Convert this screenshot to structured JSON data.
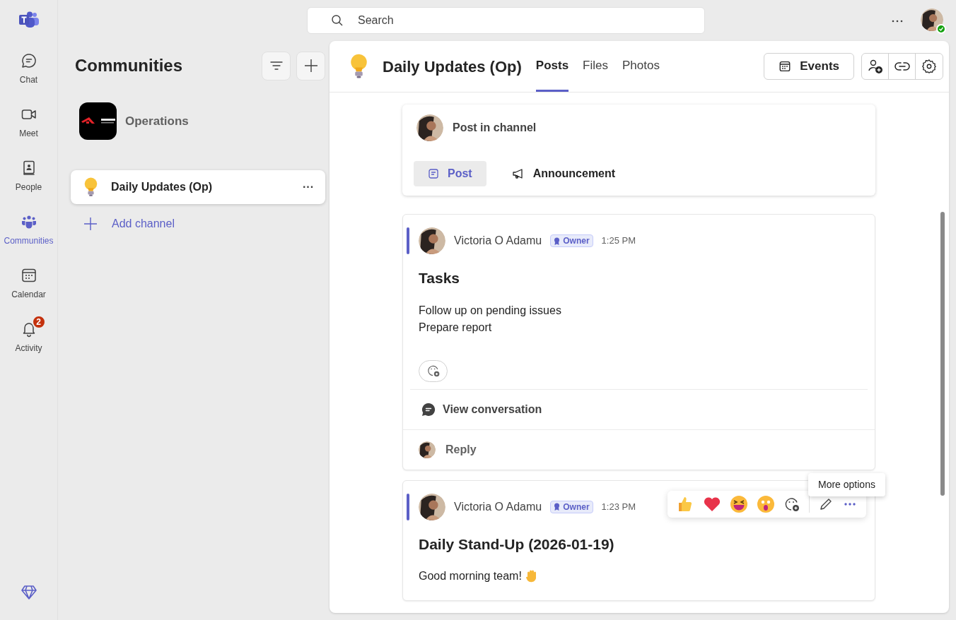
{
  "search": {
    "placeholder": "Search"
  },
  "rail": [
    {
      "label": "Chat",
      "selected": false
    },
    {
      "label": "Meet",
      "selected": false
    },
    {
      "label": "People",
      "selected": false
    },
    {
      "label": "Communities",
      "selected": true
    },
    {
      "label": "Calendar",
      "selected": false
    },
    {
      "label": "Activity",
      "selected": false,
      "badge": "2"
    }
  ],
  "communities": {
    "title": "Communities",
    "community": {
      "name": "Operations"
    },
    "channels": [
      {
        "name": "Daily Updates (Op)",
        "selected": true,
        "more": "···"
      }
    ],
    "add_channel": "Add channel"
  },
  "channel": {
    "title": "Daily Updates (Op)",
    "tabs": [
      {
        "label": "Posts",
        "selected": true
      },
      {
        "label": "Files",
        "selected": false
      },
      {
        "label": "Photos",
        "selected": false
      }
    ],
    "events_button": "Events",
    "composer": {
      "placeholder": "Post in channel",
      "modes": [
        {
          "label": "Post",
          "selected": true
        },
        {
          "label": "Announcement",
          "selected": false
        }
      ]
    },
    "posts": [
      {
        "author": "Victoria O Adamu",
        "role": "Owner",
        "time": "1:25 PM",
        "title": "Tasks",
        "lines": [
          "Follow up on pending issues",
          "Prepare report"
        ],
        "view_conversation": "View conversation",
        "reply": "Reply",
        "hovered": false
      },
      {
        "author": "Victoria O Adamu",
        "role": "Owner",
        "time": "1:23 PM",
        "title": "Daily Stand-Up (2026-01-19)",
        "lines": [
          "Good morning team!"
        ],
        "hovered": true
      }
    ],
    "tooltip": "More options"
  }
}
